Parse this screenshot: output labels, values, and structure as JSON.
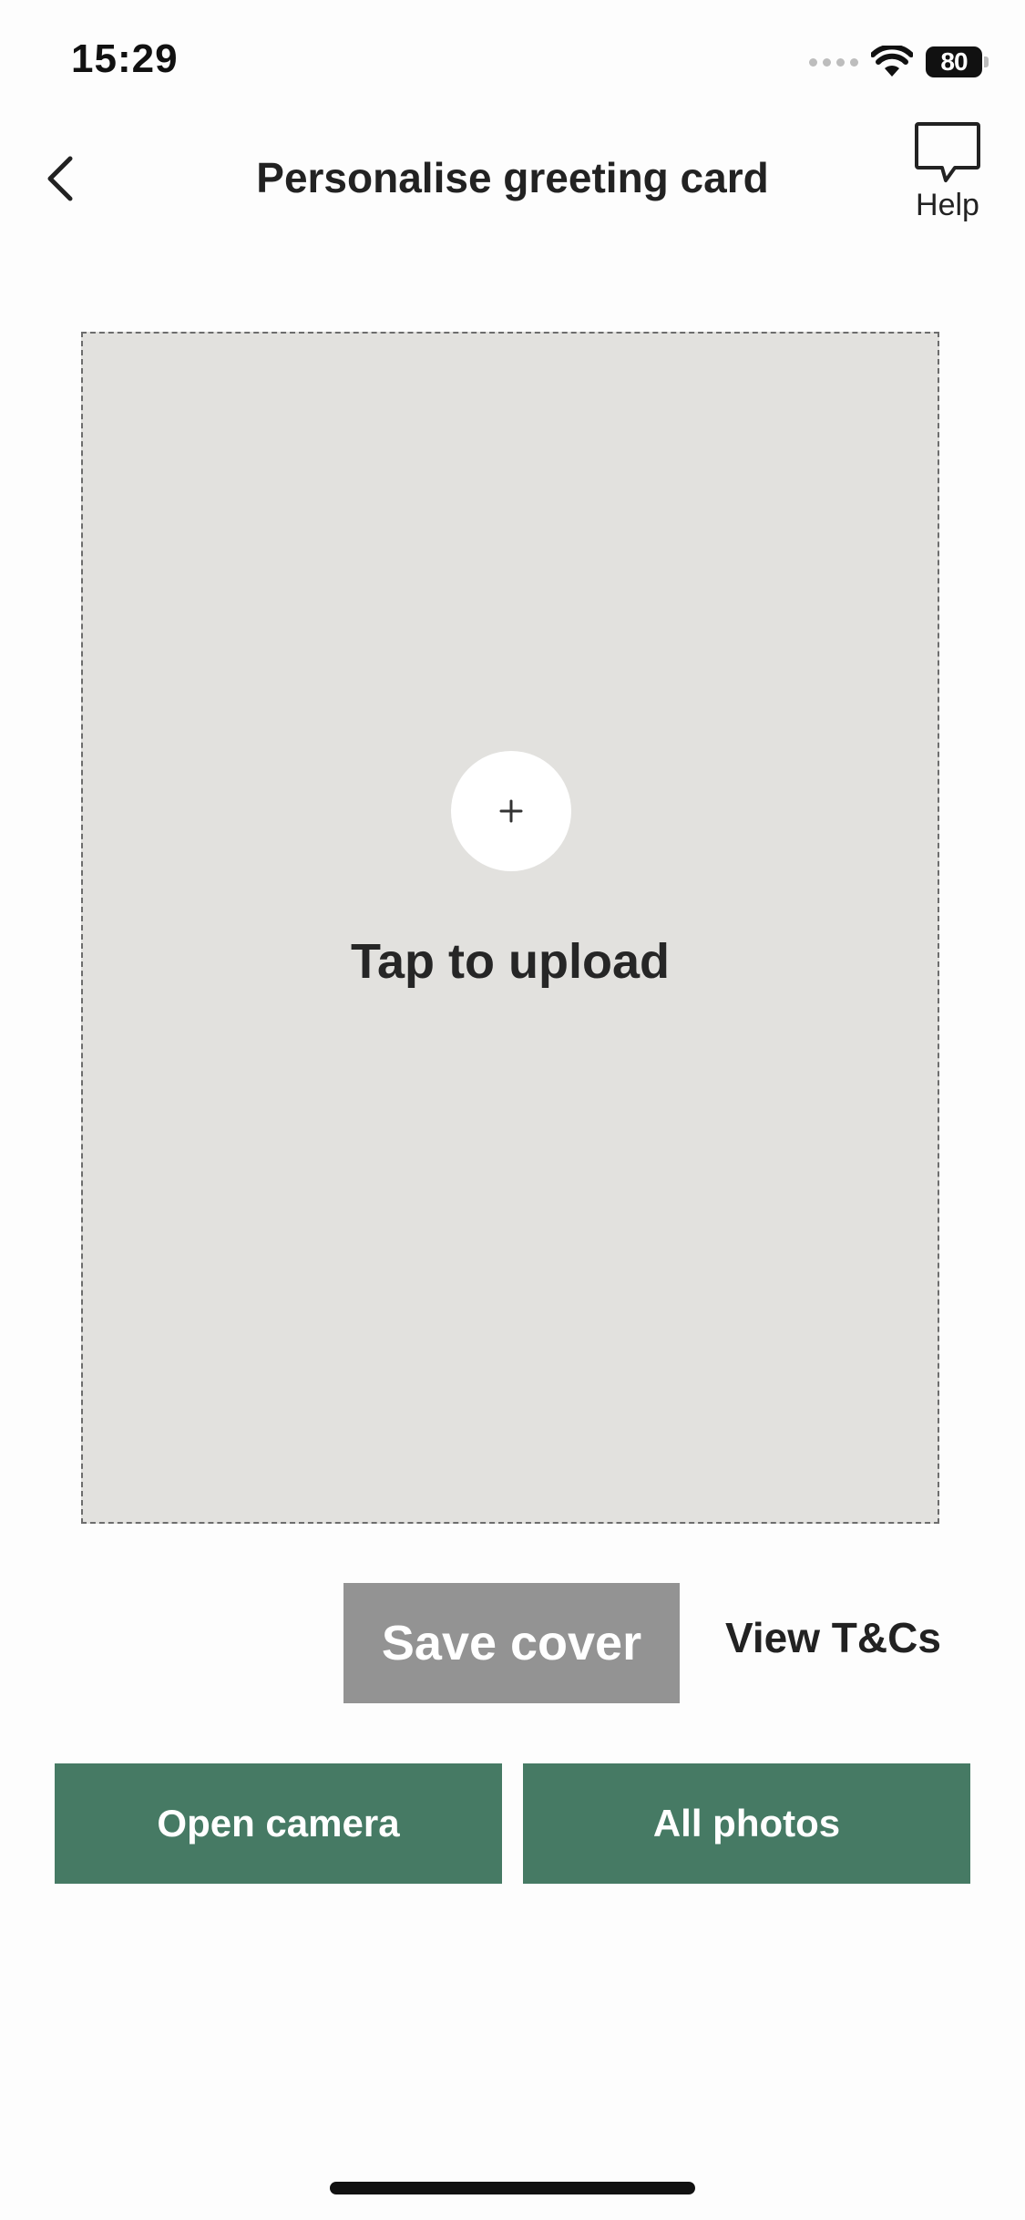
{
  "status_bar": {
    "time": "15:29",
    "battery": "80",
    "icons": [
      "cellular-dots-icon",
      "wifi-icon",
      "battery-icon"
    ]
  },
  "nav": {
    "back_icon": "chevron-left-icon",
    "title": "Personalise greeting card",
    "help_icon": "speech-bubble-icon",
    "help_label": "Help"
  },
  "upload": {
    "icon": "plus-icon",
    "label": "Tap to upload"
  },
  "actions": {
    "save_cover": "Save cover",
    "view_tcs": "View T&Cs",
    "open_camera": "Open camera",
    "all_photos": "All photos"
  },
  "colors": {
    "accent_green": "#467a64",
    "disabled_gray": "#939393",
    "upload_bg": "#e2e1de"
  }
}
